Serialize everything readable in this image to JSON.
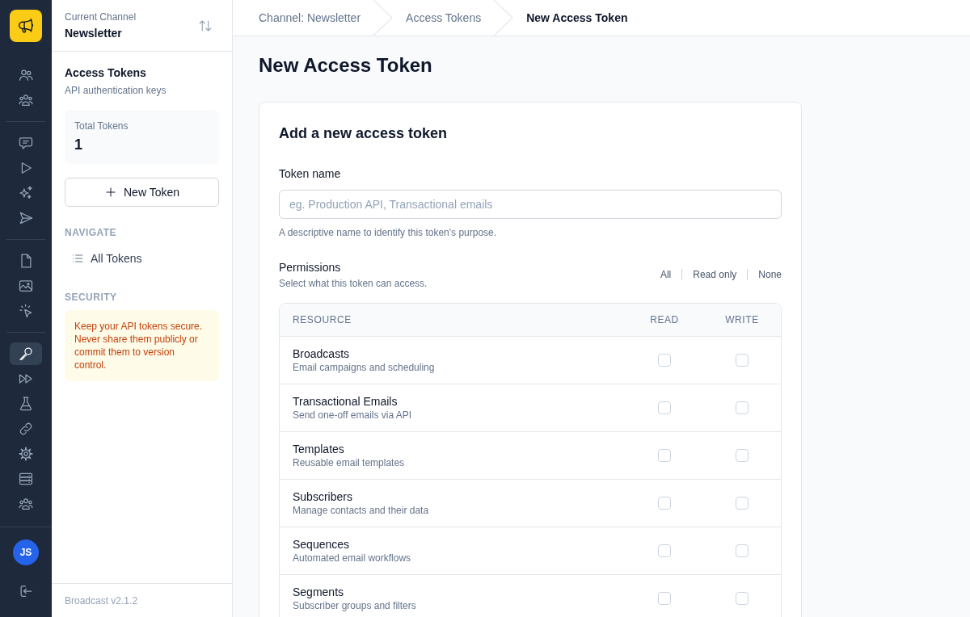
{
  "rail": {
    "groups": [
      {
        "items": [
          {
            "selected": false
          },
          {
            "selected": false
          }
        ]
      },
      {
        "items": [
          {
            "selected": false
          },
          {
            "selected": false
          },
          {
            "selected": false
          },
          {
            "selected": false
          }
        ]
      },
      {
        "items": [
          {
            "selected": false
          },
          {
            "selected": false
          },
          {
            "selected": false
          }
        ]
      },
      {
        "items": [
          {
            "selected": true
          },
          {
            "selected": false
          },
          {
            "selected": false
          },
          {
            "selected": false
          },
          {
            "selected": false
          },
          {
            "selected": false
          },
          {
            "selected": false
          }
        ]
      }
    ],
    "avatar": "JS"
  },
  "sidebar": {
    "channel": {
      "label": "Current Channel",
      "name": "Newsletter"
    },
    "section": {
      "title": "Access Tokens",
      "subtitle": "API authentication keys"
    },
    "stat": {
      "label": "Total Tokens",
      "value": "1"
    },
    "new_button": "New Token",
    "navigate": {
      "heading": "NAVIGATE",
      "items": [
        {
          "label": "All Tokens",
          "selected": false
        }
      ]
    },
    "security": {
      "heading": "SECURITY",
      "note": "Keep your API tokens secure. Never share them publicly or commit them to version control."
    },
    "footer": "Broadcast v2.1.2"
  },
  "breadcrumbs": [
    {
      "label": "Channel: Newsletter",
      "current": false
    },
    {
      "label": "Access Tokens",
      "current": false
    },
    {
      "label": "New Access Token",
      "current": true
    }
  ],
  "page_title": "New Access Token",
  "form": {
    "title": "Add a new access token",
    "token_name": {
      "label": "Token name",
      "placeholder": "eg. Production API, Transactional emails",
      "help": "A descriptive name to identify this token's purpose."
    },
    "permissions": {
      "label": "Permissions",
      "hint": "Select what this token can access.",
      "presets": [
        "All",
        "Read only",
        "None"
      ],
      "columns": [
        "RESOURCE",
        "READ",
        "WRITE"
      ],
      "rows": [
        {
          "name": "Broadcasts",
          "description": "Email campaigns and scheduling",
          "read": false,
          "write": false
        },
        {
          "name": "Transactional Emails",
          "description": "Send one-off emails via API",
          "read": false,
          "write": false
        },
        {
          "name": "Templates",
          "description": "Reusable email templates",
          "read": false,
          "write": false
        },
        {
          "name": "Subscribers",
          "description": "Manage contacts and their data",
          "read": false,
          "write": false
        },
        {
          "name": "Sequences",
          "description": "Automated email workflows",
          "read": false,
          "write": false
        },
        {
          "name": "Segments",
          "description": "Subscriber groups and filters",
          "read": false,
          "write": false
        }
      ]
    }
  }
}
